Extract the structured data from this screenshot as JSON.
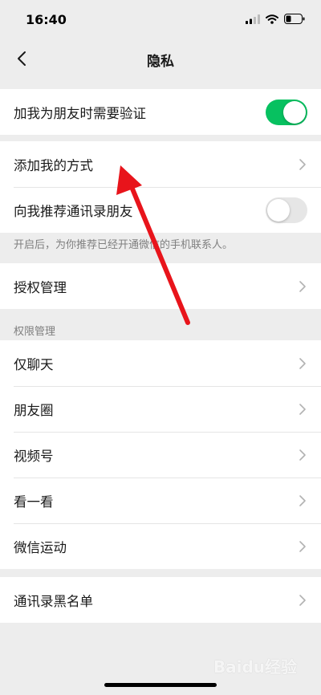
{
  "status_bar": {
    "time": "16:40"
  },
  "nav": {
    "title": "隐私"
  },
  "sections": {
    "verify": {
      "label": "加我为朋友时需要验证",
      "enabled": true
    },
    "add_methods": {
      "label": "添加我的方式"
    },
    "recommend": {
      "label": "向我推荐通讯录朋友",
      "enabled": false
    },
    "recommend_note": "开启后，为你推荐已经开通微信的手机联系人。",
    "authorization": {
      "label": "授权管理"
    },
    "permissions_header": "权限管理",
    "permissions": [
      {
        "label": "仅聊天"
      },
      {
        "label": "朋友圈"
      },
      {
        "label": "视频号"
      },
      {
        "label": "看一看"
      },
      {
        "label": "微信运动"
      }
    ],
    "blacklist": {
      "label": "通讯录黑名单"
    }
  },
  "watermark": "Baidu经验",
  "colors": {
    "toggle_on": "#07c160",
    "toggle_off": "#e6e6e6",
    "annotation_arrow": "#e8141b",
    "page_bg": "#ededed"
  },
  "icons": {
    "back": "chevron-left-icon",
    "chevron": "chevron-right-icon",
    "signal": "signal-icon",
    "wifi": "wifi-icon",
    "battery": "battery-icon"
  }
}
